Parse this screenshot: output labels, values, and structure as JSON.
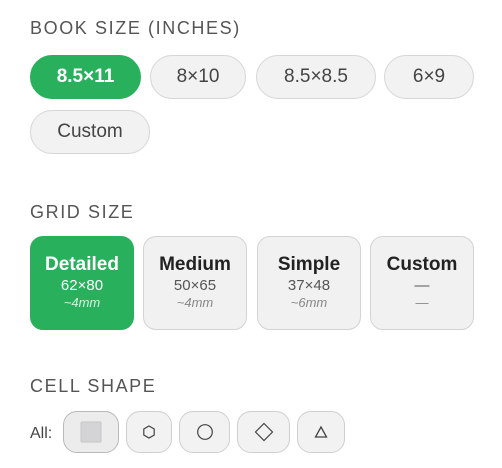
{
  "book_size": {
    "title": "BOOK SIZE (INCHES)",
    "options": [
      "8.5×11",
      "8×10",
      "8.5×8.5",
      "6×9",
      "Custom"
    ],
    "selected": "8.5×11"
  },
  "grid_size": {
    "title": "GRID SIZE",
    "options": [
      {
        "label": "Detailed",
        "dims": "62×80",
        "mm": "~4mm"
      },
      {
        "label": "Medium",
        "dims": "50×65",
        "mm": "~4mm"
      },
      {
        "label": "Simple",
        "dims": "37×48",
        "mm": "~6mm"
      },
      {
        "label": "Custom",
        "dims": "—",
        "mm": "—"
      }
    ],
    "selected": "Detailed"
  },
  "cell_shape": {
    "title": "CELL SHAPE",
    "all_label": "All:",
    "shapes": [
      "square-icon",
      "hexagon-icon",
      "circle-icon",
      "diamond-icon",
      "triangle-icon"
    ],
    "selected": "square-icon"
  },
  "colors": {
    "accent": "#28b05c",
    "button_bg": "#f2f2f3"
  }
}
